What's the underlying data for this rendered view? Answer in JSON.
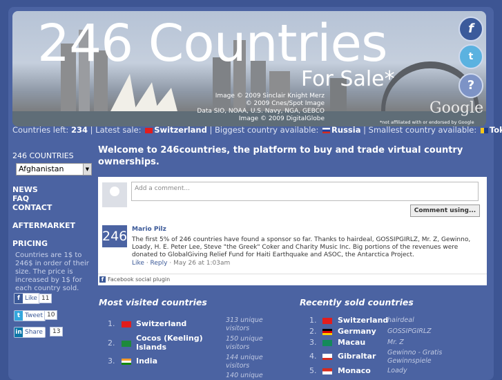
{
  "banner": {
    "title": "246 Countries",
    "subtitle": "For Sale*",
    "credits": [
      "Image © 2009 Sinclair Knight Merz",
      "© 2009 Cnes/Spot Image",
      "Data SIO, NOAA, U.S. Navy, NGA, GEBCO",
      "Image © 2009 DigitalGlobe"
    ],
    "google": "Google",
    "not_affiliated": "*not affiliated with or endorsed by Google",
    "social": {
      "facebook": "f",
      "twitter": "t",
      "help": "?"
    }
  },
  "status": {
    "countries_left_label": "Countries left:",
    "countries_left": "234",
    "latest_sale_label": "| Latest sale:",
    "latest_sale": "Switzerland",
    "biggest_label": "| Biggest country available:",
    "biggest": "Russia",
    "smallest_label": "| Smallest country available:",
    "smallest": "Tokelau"
  },
  "sidebar": {
    "countries_prefix": "246",
    "countries_label": "COUNTRIES",
    "selected_country": "Afghanistan",
    "nav": [
      "NEWS",
      "FAQ",
      "CONTACT",
      "AFTERMARKET",
      "PRICING"
    ],
    "pricing_text": "Countries are 1$ to 246$ in order of their size. The price is increased by 1$ for each country sold.",
    "like_label": "Like",
    "like_count": "11",
    "tweet_label": "Tweet",
    "tweet_count": "10",
    "share_label": "Share",
    "share_count": "13"
  },
  "main": {
    "welcome": "Welcome to 246countries, the platform to buy and trade virtual country ownerships.",
    "comments": {
      "placeholder": "Add a comment...",
      "comment_using": "Comment using...",
      "avatar_text": "246",
      "author": "Mario Pilz",
      "text": "The first 5% of 246 countries have found a sponsor so far. Thanks to hairdeal, GOSSIPGIRLZ, Mr. Z, Gewinno, Loady, H. E. Peter Lee, Steve \"the Greek\" Coker and Charity Music Inc. Big portions of the revenues were donated to GlobalGiving Relief Fund for Haiti Earthquake and ASOC, the Antarctica Project.",
      "like": "Like",
      "reply": "Reply",
      "date": "May 26 at 1:03am",
      "plugin": "Facebook social plugin"
    }
  },
  "most_visited": {
    "title": "Most visited countries",
    "rows": [
      {
        "num": "1.",
        "name": "Switzerland",
        "visits": "313 unique visitors"
      },
      {
        "num": "2.",
        "name": "Cocos (Keeling) Islands",
        "visits": "150 unique visitors"
      },
      {
        "num": "3.",
        "name": "India",
        "visits": "144 unique visitors"
      },
      {
        "num": "",
        "name": "",
        "visits": "140 unique"
      }
    ]
  },
  "recently_sold": {
    "title": "Recently sold countries",
    "rows": [
      {
        "num": "1.",
        "name": "Switzerland",
        "buyer": "hairdeal"
      },
      {
        "num": "2.",
        "name": "Germany",
        "buyer": "GOSSIPGIRLZ"
      },
      {
        "num": "3.",
        "name": "Macau",
        "buyer": "Mr. Z"
      },
      {
        "num": "4.",
        "name": "Gibraltar",
        "buyer": "Gewinno - Gratis Gewinnspiele"
      },
      {
        "num": "5.",
        "name": "Monaco",
        "buyer": "Loady"
      }
    ]
  }
}
